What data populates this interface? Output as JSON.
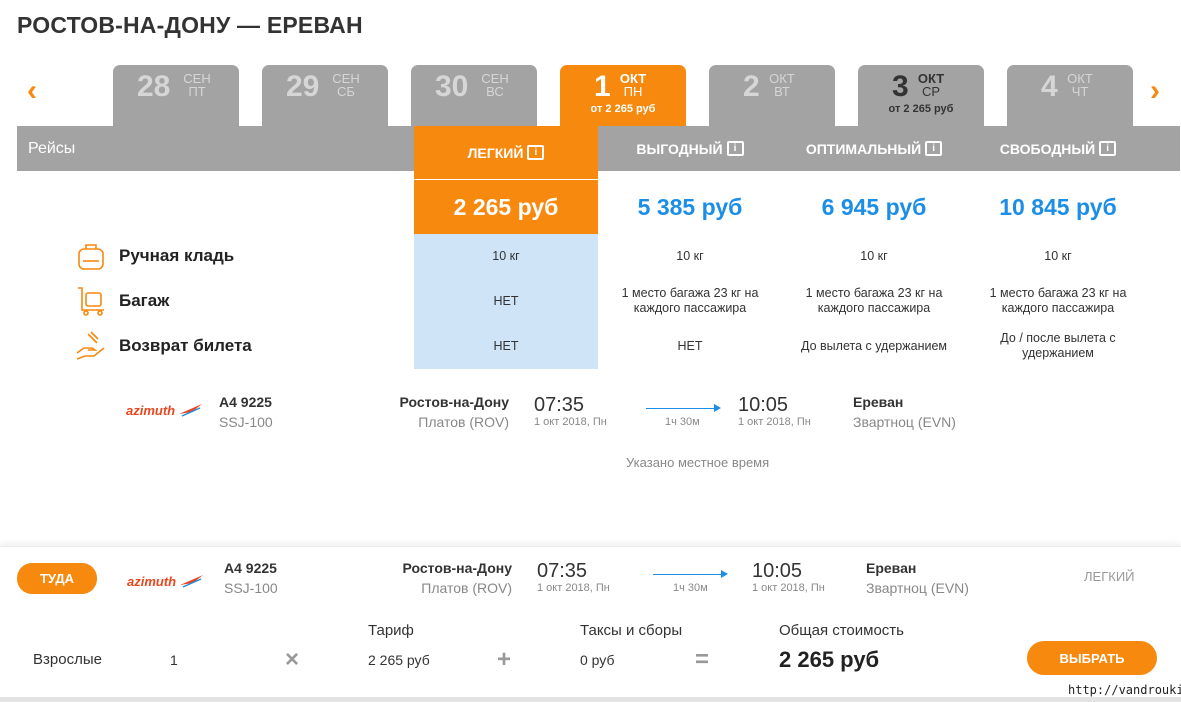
{
  "route_title": "РОСТОВ-НА-ДОНУ — ЕРЕВАН",
  "nav": {
    "prev": "‹",
    "next": "›"
  },
  "dates": [
    {
      "day": "28",
      "month": "СЕН",
      "weekday": "ПТ",
      "price": ""
    },
    {
      "day": "29",
      "month": "СЕН",
      "weekday": "СБ",
      "price": ""
    },
    {
      "day": "30",
      "month": "СЕН",
      "weekday": "ВС",
      "price": ""
    },
    {
      "day": "1",
      "month": "ОКТ",
      "weekday": "ПН",
      "price": "от 2 265 руб"
    },
    {
      "day": "2",
      "month": "ОКТ",
      "weekday": "ВТ",
      "price": ""
    },
    {
      "day": "3",
      "month": "ОКТ",
      "weekday": "СР",
      "price": "от 2 265 руб"
    },
    {
      "day": "4",
      "month": "ОКТ",
      "weekday": "ЧТ",
      "price": ""
    }
  ],
  "fare_bar": {
    "flights_label": "Рейсы",
    "fares": [
      "ЛЕГКИЙ",
      "ВЫГОДНЫЙ",
      "ОПТИМАЛЬНЫЙ",
      "СВОБОДНЫЙ"
    ]
  },
  "prices": [
    "2 265 руб",
    "5 385 руб",
    "6 945 руб",
    "10 845 руб"
  ],
  "features": [
    {
      "label": "Ручная кладь",
      "icon": "bag-icon",
      "values": [
        "10 кг",
        "10 кг",
        "10 кг",
        "10 кг"
      ]
    },
    {
      "label": "Багаж",
      "icon": "luggage-cart-icon",
      "values": [
        "НЕТ",
        "1 место багажа 23 кг на каждого пассажира",
        "1 место багажа 23 кг на каждого пассажира",
        "1 место багажа 23 кг на каждого пассажира"
      ]
    },
    {
      "label": "Возврат билета",
      "icon": "refund-hand-icon",
      "values": [
        "НЕТ",
        "НЕТ",
        "До вылета с удержанием",
        "До / после вылета с удержанием"
      ]
    }
  ],
  "flight": {
    "airline": "azimuth",
    "number": "А4 9225",
    "aircraft": "SSJ-100",
    "from_city": "Ростов-на-Дону",
    "from_airport": "Платов (ROV)",
    "dep_time": "07:35",
    "dep_date": "1 окт 2018, Пн",
    "duration": "1ч 30м",
    "arr_time": "10:05",
    "arr_date": "1 окт 2018, Пн",
    "to_city": "Ереван",
    "to_airport": "Звартноц (EVN)"
  },
  "local_time_note": "Указано местное время",
  "summary": {
    "direction_button": "ТУДА",
    "selected_fare": "ЛЕГКИЙ",
    "passenger_label": "Взрослые",
    "passenger_count": "1",
    "times_sign": "×",
    "tariff_label": "Тариф",
    "tariff_value": "2 265 руб",
    "plus_sign": "+",
    "taxes_label": "Таксы и сборы",
    "taxes_value": "0 руб",
    "equals_sign": "=",
    "total_label": "Общая стоимость",
    "total_value": "2 265 руб",
    "choose_button": "ВЫБРАТЬ"
  },
  "watermark": "http://vandrouki.ru/",
  "colors": {
    "accent": "#f7890e",
    "price_blue": "#1d8ee6",
    "tab_grey": "#a3a3a3",
    "light_fare_bg": "#cfe5f7"
  }
}
